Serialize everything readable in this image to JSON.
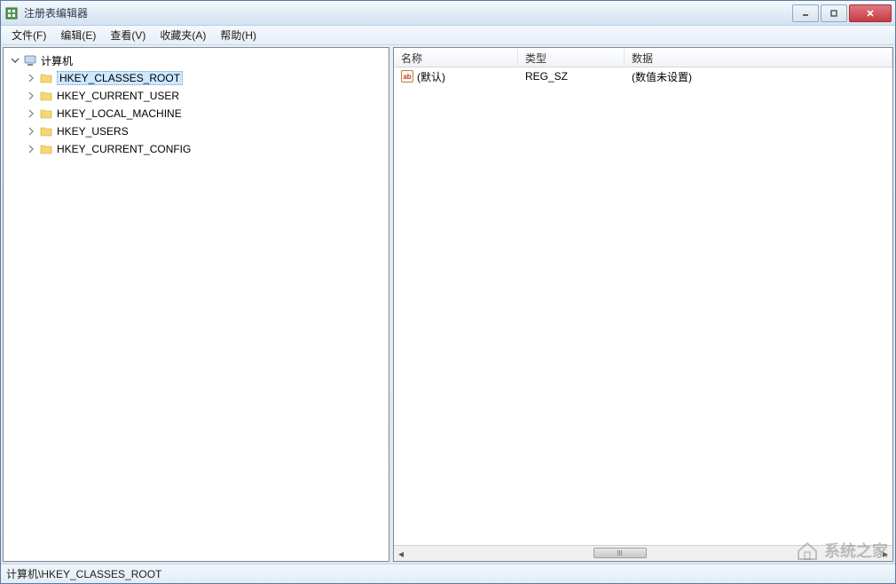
{
  "window": {
    "title": "注册表编辑器"
  },
  "menu": {
    "items": [
      "文件(F)",
      "编辑(E)",
      "查看(V)",
      "收藏夹(A)",
      "帮助(H)"
    ]
  },
  "tree": {
    "root": {
      "label": "计算机",
      "expanded": true
    },
    "keys": [
      {
        "label": "HKEY_CLASSES_ROOT",
        "selected": true
      },
      {
        "label": "HKEY_CURRENT_USER",
        "selected": false
      },
      {
        "label": "HKEY_LOCAL_MACHINE",
        "selected": false
      },
      {
        "label": "HKEY_USERS",
        "selected": false
      },
      {
        "label": "HKEY_CURRENT_CONFIG",
        "selected": false
      }
    ]
  },
  "list": {
    "columns": {
      "name": "名称",
      "type": "类型",
      "data": "数据"
    },
    "rows": [
      {
        "icon_text": "ab",
        "name": "(默认)",
        "type": "REG_SZ",
        "data": "(数值未设置)"
      }
    ]
  },
  "statusbar": {
    "path": "计算机\\HKEY_CLASSES_ROOT"
  },
  "watermark": {
    "text": "系统之家"
  }
}
